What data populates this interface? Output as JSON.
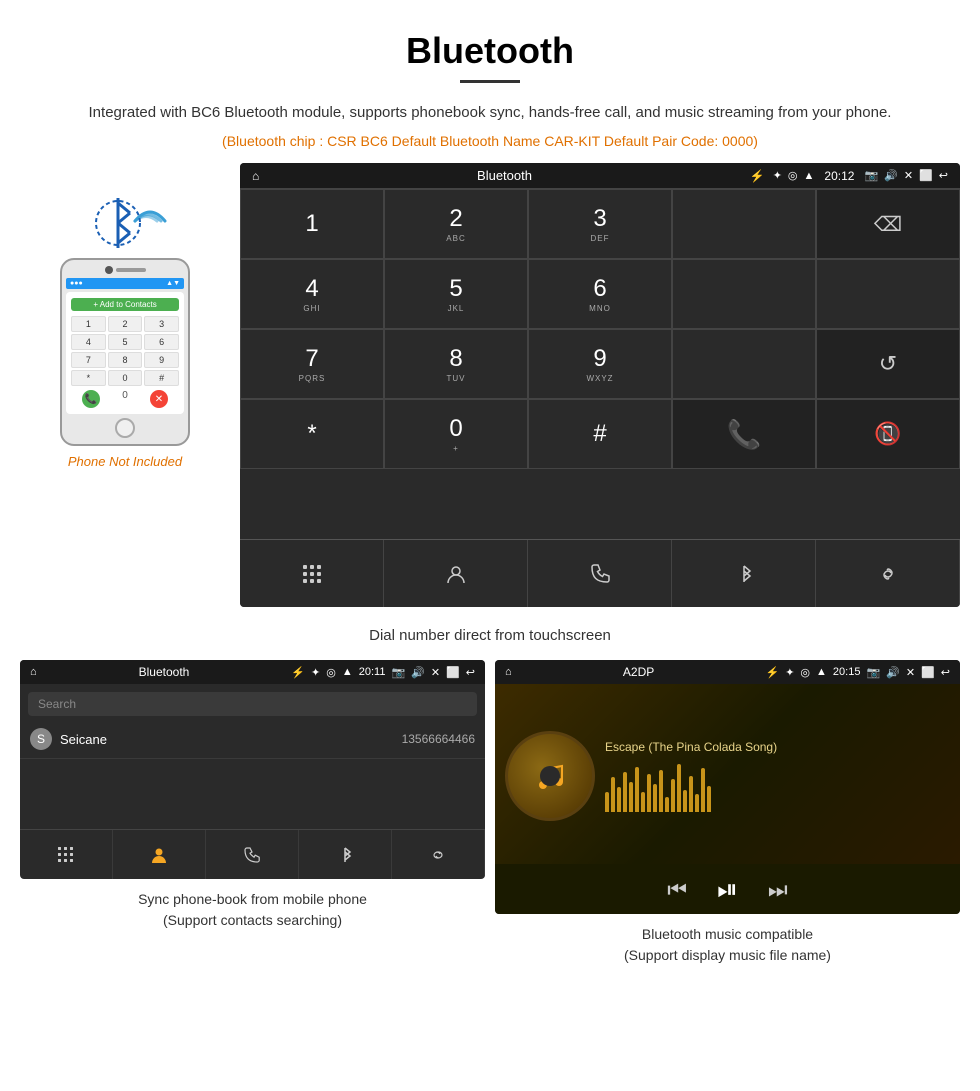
{
  "page": {
    "title": "Bluetooth",
    "subtitle": "Integrated with BC6 Bluetooth module, supports phonebook sync, hands-free call, and music streaming from your phone.",
    "spec_line": "(Bluetooth chip : CSR BC6    Default Bluetooth Name CAR-KIT    Default Pair Code: 0000)",
    "dial_caption": "Dial number direct from touchscreen",
    "phone_not_included": "Phone Not Included"
  },
  "car_screen": {
    "status_bar": {
      "title": "Bluetooth",
      "time": "20:12"
    },
    "keypad": [
      {
        "main": "1",
        "sub": ""
      },
      {
        "main": "2",
        "sub": "ABC"
      },
      {
        "main": "3",
        "sub": "DEF"
      },
      {
        "main": "",
        "sub": ""
      },
      {
        "main": "⌫",
        "sub": ""
      },
      {
        "main": "4",
        "sub": "GHI"
      },
      {
        "main": "5",
        "sub": "JKL"
      },
      {
        "main": "6",
        "sub": "MNO"
      },
      {
        "main": "",
        "sub": ""
      },
      {
        "main": "",
        "sub": ""
      },
      {
        "main": "7",
        "sub": "PQRS"
      },
      {
        "main": "8",
        "sub": "TUV"
      },
      {
        "main": "9",
        "sub": "WXYZ"
      },
      {
        "main": "",
        "sub": ""
      },
      {
        "main": "↺",
        "sub": ""
      },
      {
        "main": "*",
        "sub": ""
      },
      {
        "main": "0",
        "sub": "+"
      },
      {
        "main": "#",
        "sub": ""
      },
      {
        "main": "✆",
        "sub": ""
      },
      {
        "main": "✆",
        "sub": ""
      }
    ]
  },
  "phonebook_screen": {
    "status_bar": {
      "title": "Bluetooth",
      "time": "20:11"
    },
    "search_placeholder": "Search",
    "contact": {
      "letter": "S",
      "name": "Seicane",
      "number": "13566664466"
    }
  },
  "music_screen": {
    "status_bar": {
      "title": "A2DP",
      "time": "20:15"
    },
    "song_title": "Escape (The Pina Colada Song)"
  },
  "bottom_cards": [
    {
      "caption_line1": "Sync phone-book from mobile phone",
      "caption_line2": "(Support contacts searching)"
    },
    {
      "caption_line1": "Bluetooth music compatible",
      "caption_line2": "(Support display music file name)"
    }
  ]
}
